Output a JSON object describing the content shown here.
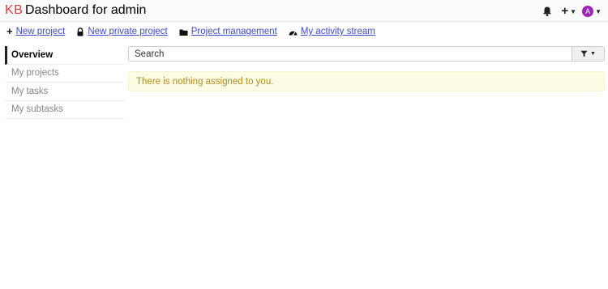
{
  "header": {
    "logo": "KB",
    "title": "Dashboard for admin",
    "avatar_letter": "A",
    "icons": [
      "bell-icon",
      "plus-icon",
      "chevron-down-icon",
      "avatar"
    ]
  },
  "actions": [
    {
      "label": "New project",
      "icon": "plus-icon"
    },
    {
      "label": "New private project",
      "icon": "lock-icon"
    },
    {
      "label": "Project management",
      "icon": "folder-icon"
    },
    {
      "label": "My activity stream",
      "icon": "dashboard-icon"
    }
  ],
  "sidebar": {
    "items": [
      {
        "label": "Overview",
        "active": true
      },
      {
        "label": "My projects",
        "active": false
      },
      {
        "label": "My tasks",
        "active": false
      },
      {
        "label": "My subtasks",
        "active": false
      }
    ]
  },
  "search": {
    "placeholder": "Search"
  },
  "alert": {
    "message": "There is nothing assigned to you."
  },
  "colors": {
    "logo": "#dd4040",
    "avatar": "#9c27b0",
    "alert_bg": "#fcfce4",
    "alert_text": "#b08b24",
    "link": "#3d4bd0"
  }
}
